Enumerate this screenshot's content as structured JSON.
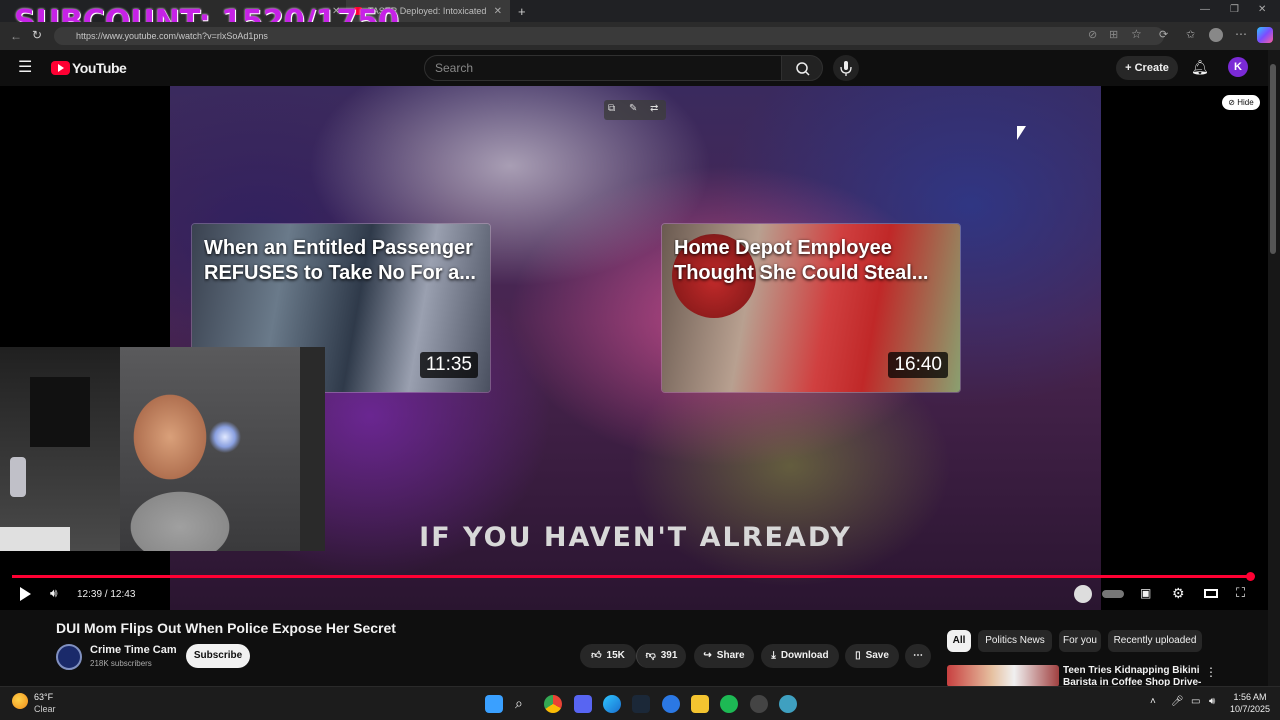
{
  "browser": {
    "overlay": "SUBCOUNT: 1520/1750",
    "tabs": [
      {
        "label": "TASER Deployed: Intoxicated Do"
      }
    ],
    "url": "https://www.youtube.com/watch?v=rlxSoAd1pns"
  },
  "youtube": {
    "logo_text": "YouTube",
    "search_placeholder": "Search",
    "create_label": "Create",
    "hide_label": "Hide"
  },
  "player": {
    "endcards": [
      {
        "title": "When an Entitled Passenger REFUSES to Take No For a...",
        "duration": "11:35"
      },
      {
        "title": "Home Depot Employee Thought She Could Steal...",
        "duration": "16:40"
      }
    ],
    "caption": "IF YOU HAVEN'T ALREADY",
    "time": "12:39 / 12:43",
    "progress": 0.995
  },
  "video": {
    "title": "DUI Mom Flips Out When Police Expose Her Secret",
    "channel": "Crime Time Cam",
    "subscribers": "218K subscribers",
    "subscribe_label": "Subscribe",
    "likes": "15K",
    "dislikes": "391",
    "share_label": "Share",
    "download_label": "Download",
    "save_label": "Save"
  },
  "filters": [
    "All",
    "Politics News",
    "For you",
    "Recently uploaded"
  ],
  "recommended": {
    "title": "Teen Tries Kidnapping Bikini Barista in Coffee Shop Drive-"
  },
  "taskbar": {
    "temperature": "63°F",
    "condition": "Clear",
    "time": "1:56 AM",
    "date": "10/7/2025"
  },
  "colors": {
    "accent": "#ff0033",
    "overlay": "#c622e6"
  }
}
